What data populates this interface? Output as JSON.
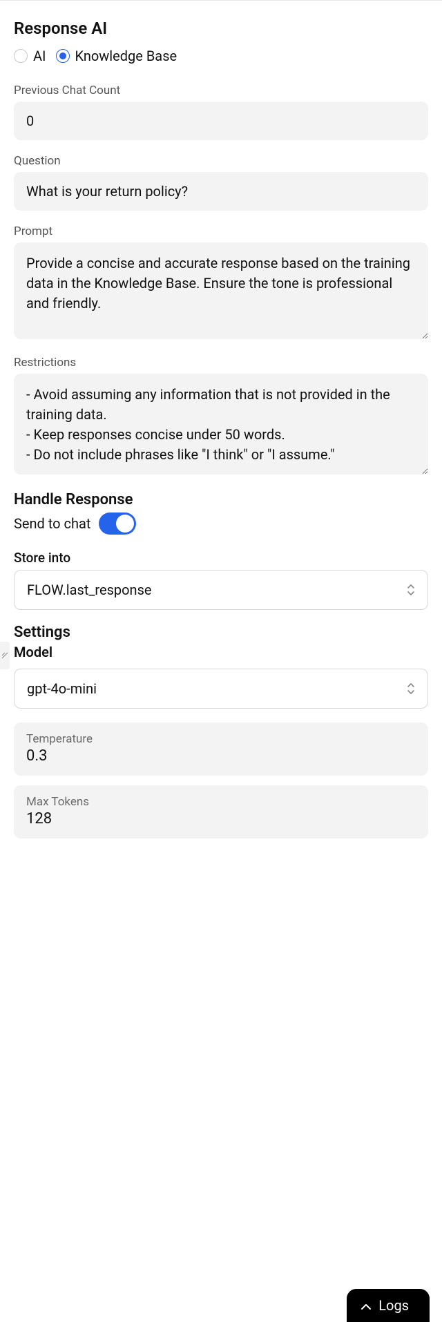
{
  "responseAI": {
    "title": "Response AI",
    "options": {
      "ai": "AI",
      "kb": "Knowledge Base"
    },
    "previousChatCount": {
      "label": "Previous Chat Count",
      "value": "0"
    },
    "question": {
      "label": "Question",
      "value": "What is your return policy?"
    },
    "prompt": {
      "label": "Prompt",
      "value": "Provide a concise and accurate response based on the training data in the Knowledge Base. Ensure the tone is professional and friendly."
    },
    "restrictions": {
      "label": "Restrictions",
      "value": "- Avoid assuming any information that is not provided in the training data.\n- Keep responses concise under 50 words.\n- Do not include phrases like \"I think\" or \"I assume.\""
    }
  },
  "handleResponse": {
    "title": "Handle Response",
    "sendToChat": {
      "label": "Send to chat",
      "enabled": true
    },
    "storeInto": {
      "label": "Store into",
      "value": "FLOW.last_response"
    }
  },
  "settings": {
    "title": "Settings",
    "model": {
      "label": "Model",
      "value": "gpt-4o-mini"
    },
    "temperature": {
      "label": "Temperature",
      "value": "0.3"
    },
    "maxTokens": {
      "label": "Max Tokens",
      "value": "128"
    }
  },
  "logs": {
    "label": "Logs"
  }
}
